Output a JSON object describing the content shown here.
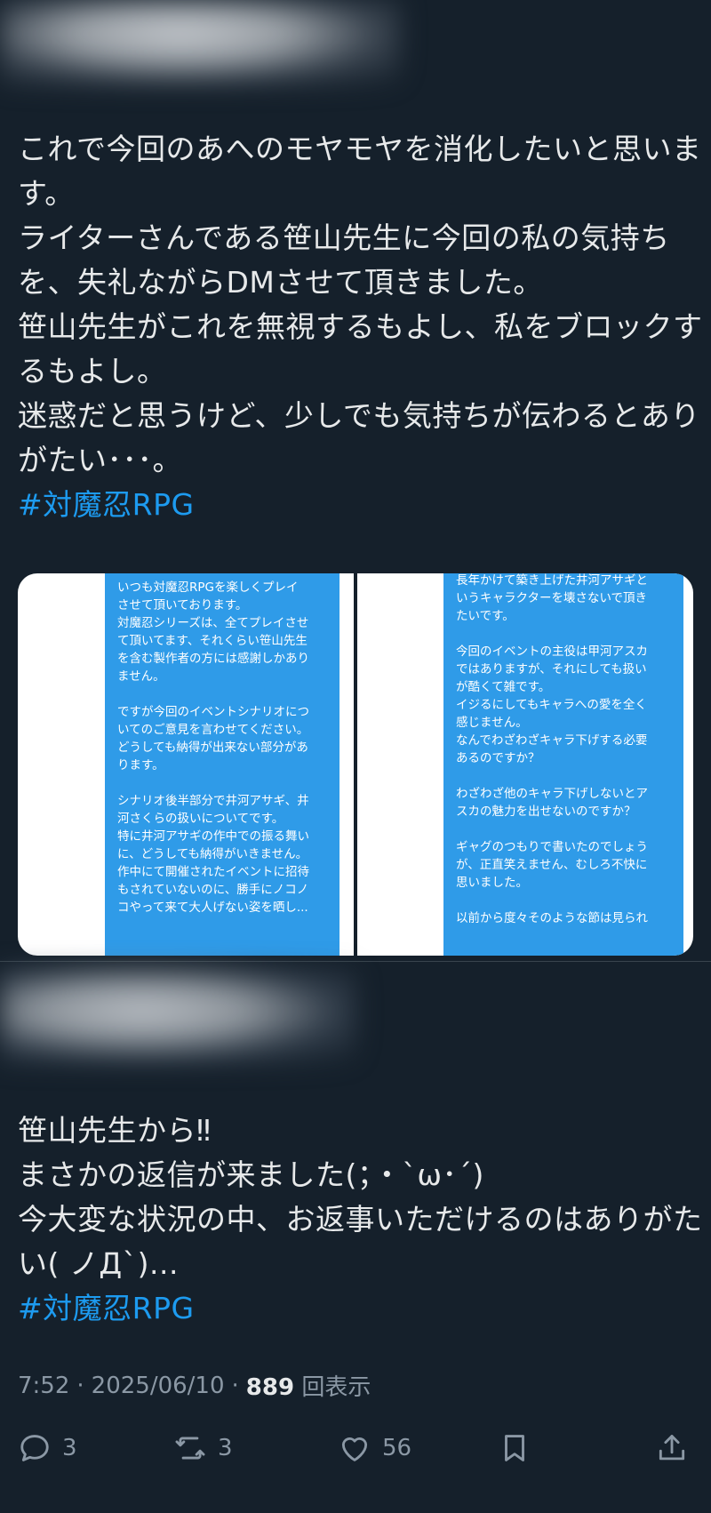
{
  "post": {
    "text_lines": [
      "これで今回のあへのモヤモヤを消化したいと思いま",
      "す。",
      "ライターさんである笹山先生に今回の私の気持ち",
      "を、失礼ながらDMさせて頂きました。",
      "笹山先生がこれを無視するもよし、私をブロックす",
      "るもよし。",
      "迷惑だと思うけど、少しでも気持ちが伝わるとあり",
      "がたい･･･。"
    ],
    "hashtag": "#対魔忍RPG"
  },
  "media": {
    "image1_lines": [
      "いつも対魔忍RPGを楽しくプレイ",
      "させて頂いております。",
      "対魔忍シリーズは、全てプレイさせ",
      "て頂いてます、それくらい笹山先生",
      "を含む製作者の方には感謝しかあり",
      "ません。",
      "",
      "ですが今回のイベントシナリオにつ",
      "いてのご意見を言わせてください。",
      "どうしても納得が出来ない部分があ",
      "ります。",
      "",
      "シナリオ後半部分で井河アサギ、井",
      "河さくらの扱いについてです。",
      "特に井河アサギの作中での振る舞い",
      "に、どうしても納得がいきません。",
      "作中にて開催されたイベントに招待",
      "もされていないのに、勝手にノコノ",
      "コやって来て大人げない姿を晒し..."
    ],
    "image2_lines": [
      "長年かけて築き上げた井河アサギと",
      "いうキャラクターを壊さないで頂き",
      "たいです。",
      "",
      "今回のイベントの主役は甲河アスカ",
      "ではありますが、それにしても扱い",
      "が酷くて雑です。",
      "イジるにしてもキャラへの愛を全く",
      "感じません。",
      "なんでわざわざキャラ下げする必要",
      "あるのですか？",
      "",
      "わざわざ他のキャラ下げしないとア",
      "スカの魅力を出せないのですか？",
      "",
      "ギャグのつもりで書いたのでしょう",
      "が、正直笑えません、むしろ不快に",
      "思いました。",
      "",
      "以前から度々そのような節は見られ"
    ]
  },
  "reply": {
    "text_lines": [
      "笹山先生から‼",
      "まさかの返信が来ました(；・`ω･´)",
      "今大変な状況の中、お返事いただけるのはありがた",
      "い( ノДˋ)..."
    ],
    "hashtag": "#対魔忍RPG"
  },
  "meta": {
    "time": "7:52",
    "date": "2025/06/10",
    "separator": "·",
    "views_count": "889",
    "views_label": "回表示"
  },
  "actions": {
    "replies": "3",
    "reposts": "3",
    "likes": "56"
  }
}
